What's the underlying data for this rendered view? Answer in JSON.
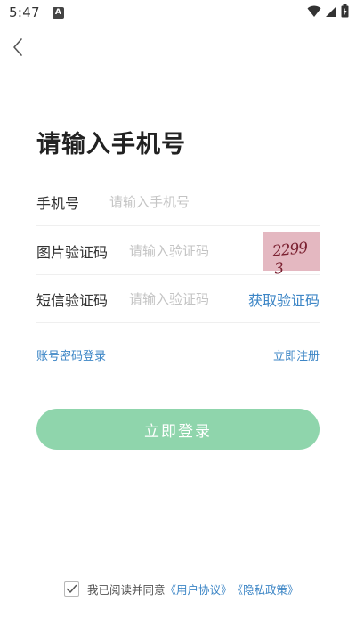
{
  "status_bar": {
    "time": "5:47",
    "notification_icon": "A"
  },
  "header": {
    "back_icon": "chevron-left-icon"
  },
  "title": "请输入手机号",
  "form": {
    "phone": {
      "label": "手机号",
      "placeholder": "请输入手机号",
      "value": ""
    },
    "image_captcha": {
      "label": "图片验证码",
      "placeholder": "请输入验证码",
      "value": "",
      "captcha_image_text": "2299 3"
    },
    "sms_code": {
      "label": "短信验证码",
      "placeholder": "请输入验证码",
      "value": "",
      "get_code_label": "获取验证码"
    }
  },
  "links": {
    "password_login": "账号密码登录",
    "register": "立即注册"
  },
  "login_button": {
    "label": "立即登录",
    "color": "#8fd5ac"
  },
  "agreement": {
    "checked": true,
    "text": "我已阅读并同意",
    "user_agreement": "《用户协议》",
    "privacy_policy": "《隐私政策》"
  },
  "colors": {
    "accent": "#3d86c6",
    "button": "#8fd5ac"
  }
}
